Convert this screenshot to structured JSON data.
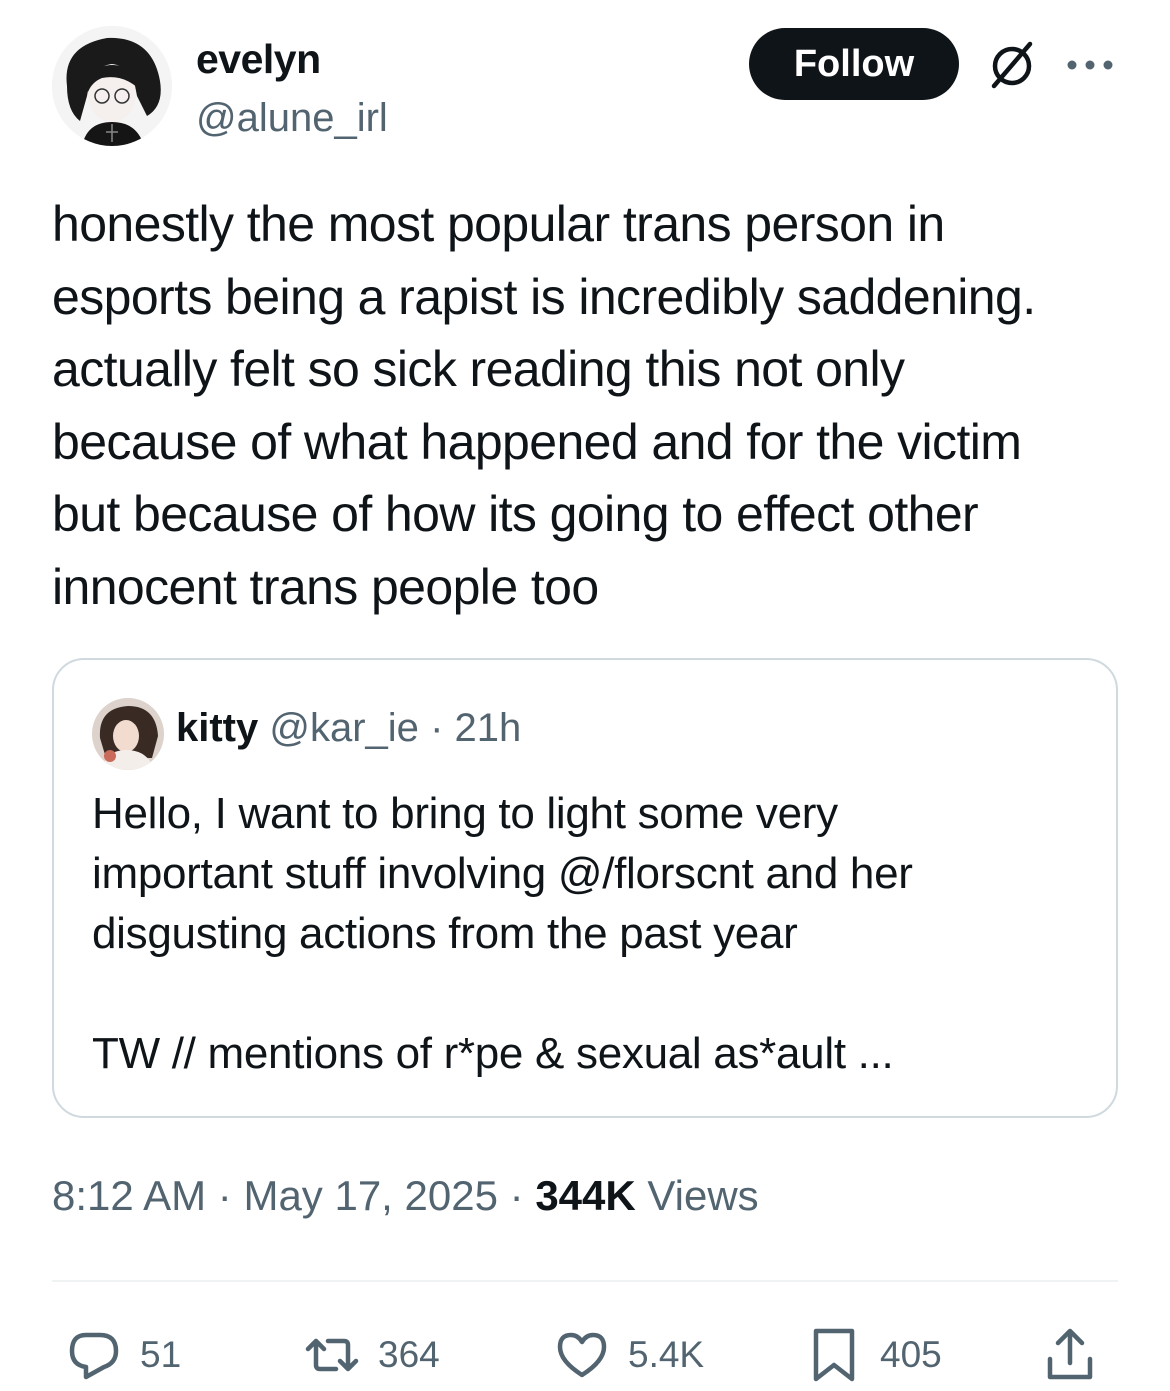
{
  "author": {
    "display_name": "evelyn",
    "handle": "@alune_irl",
    "avatar_icon": "profile-photo"
  },
  "header_actions": {
    "follow_label": "Follow",
    "grok_icon": "grok-icon",
    "more_icon": "more-icon"
  },
  "tweet": {
    "text": "honestly the most popular trans person in\nesports being a rapist is incredibly saddening.\nactually felt so sick reading this not only\nbecause of what happened and for the victim\nbut because of how its going to effect other\ninnocent trans people too"
  },
  "quoted_tweet": {
    "display_name": "kitty",
    "handle": "@kar_ie",
    "separator": "·",
    "time": "21h",
    "text": "Hello, I want to bring to light some very\nimportant stuff involving @/florscnt and her\ndisgusting actions from the past year\n\nTW // mentions of r*pe & sexual as*ault ..."
  },
  "meta": {
    "time": "8:12 AM",
    "separator": "·",
    "date": "May 17, 2025",
    "views_count": "344K",
    "views_label": "Views"
  },
  "actions": {
    "replies": "51",
    "reposts": "364",
    "likes": "5.4K",
    "bookmarks": "405"
  },
  "colors": {
    "text_primary": "#0f1419",
    "text_secondary": "#536471",
    "border": "#cfd9de",
    "follow_bg": "#0f1419"
  }
}
